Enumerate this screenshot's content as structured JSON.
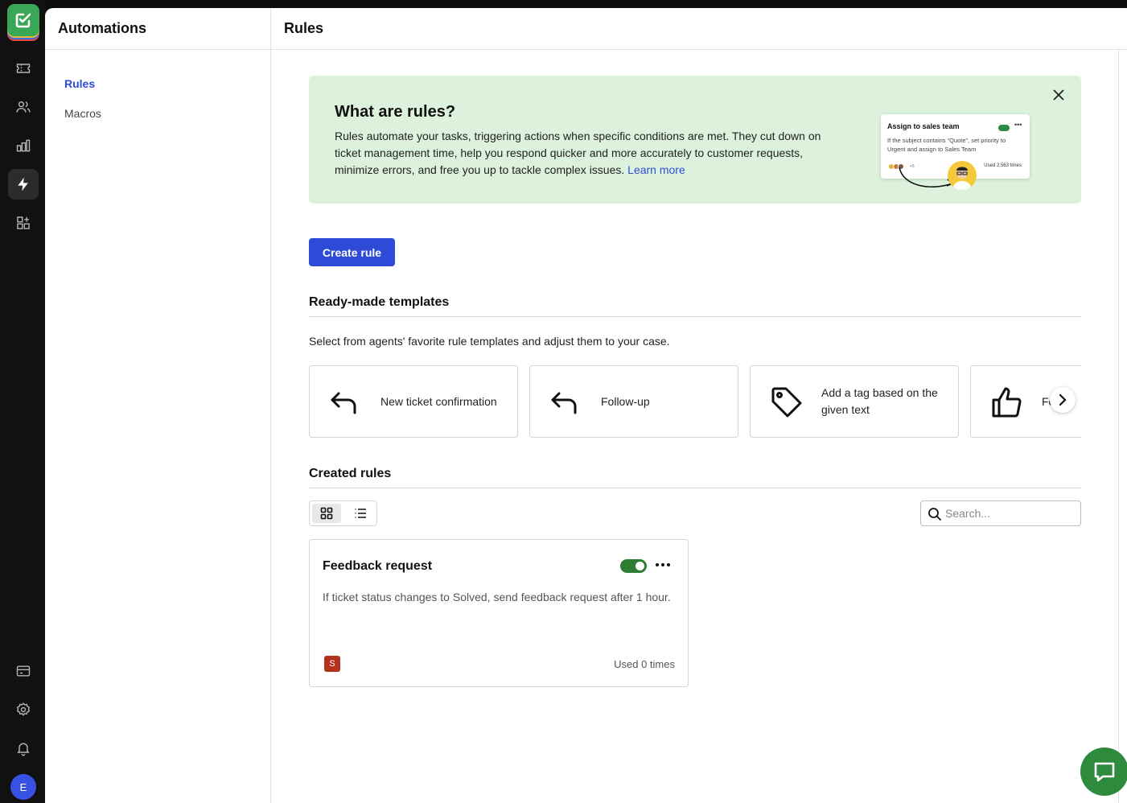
{
  "colors": {
    "accent": "#2e4bd8",
    "banner_bg": "#dcf2dc",
    "toggle_on": "#2e7d33",
    "chat": "#2e8b3e",
    "badge": "#b3321c",
    "avatar": "#3651e3"
  },
  "rail": {
    "items": [
      {
        "icon": "ticket-icon"
      },
      {
        "icon": "contacts-icon"
      },
      {
        "icon": "reports-icon"
      },
      {
        "icon": "automations-icon",
        "active": true
      },
      {
        "icon": "apps-icon"
      }
    ],
    "bottom_items": [
      {
        "icon": "billing-icon"
      },
      {
        "icon": "settings-icon"
      },
      {
        "icon": "notifications-icon"
      }
    ],
    "avatar_initial": "E"
  },
  "subnav": {
    "title": "Automations",
    "items": [
      {
        "label": "Rules",
        "active": true
      },
      {
        "label": "Macros",
        "active": false
      }
    ]
  },
  "header": {
    "title": "Rules"
  },
  "banner": {
    "title": "What are rules?",
    "text": "Rules automate your tasks, triggering actions when specific conditions are met. They cut down on ticket management time, help you respond quicker and more accurately to customer requests, minimize errors, and free you up to tackle complex issues.",
    "link": "Learn more",
    "preview": {
      "title": "Assign to sales team",
      "text": "If the subject contains “Quote”, set priority to Urgent and assign to Sales Team",
      "plus": "+5",
      "used": "Used 2,563 times"
    }
  },
  "actions": {
    "create_rule": "Create rule"
  },
  "templates": {
    "title": "Ready-made templates",
    "description": "Select from agents' favorite rule templates and adjust them to your case.",
    "items": [
      {
        "label": "New ticket confirmation",
        "icon": "reply-icon"
      },
      {
        "label": "Follow-up",
        "icon": "reply-icon"
      },
      {
        "label": "Add a tag based on the given text",
        "icon": "tag-icon"
      },
      {
        "label": "Fe... a",
        "icon": "thumbs-up-icon"
      }
    ]
  },
  "created": {
    "title": "Created rules",
    "search_placeholder": "Search...",
    "rules": [
      {
        "title": "Feedback request",
        "description": "If ticket status changes to Solved, send feedback request after 1 hour.",
        "enabled": true,
        "badge": "S",
        "used": "Used 0 times"
      }
    ]
  }
}
